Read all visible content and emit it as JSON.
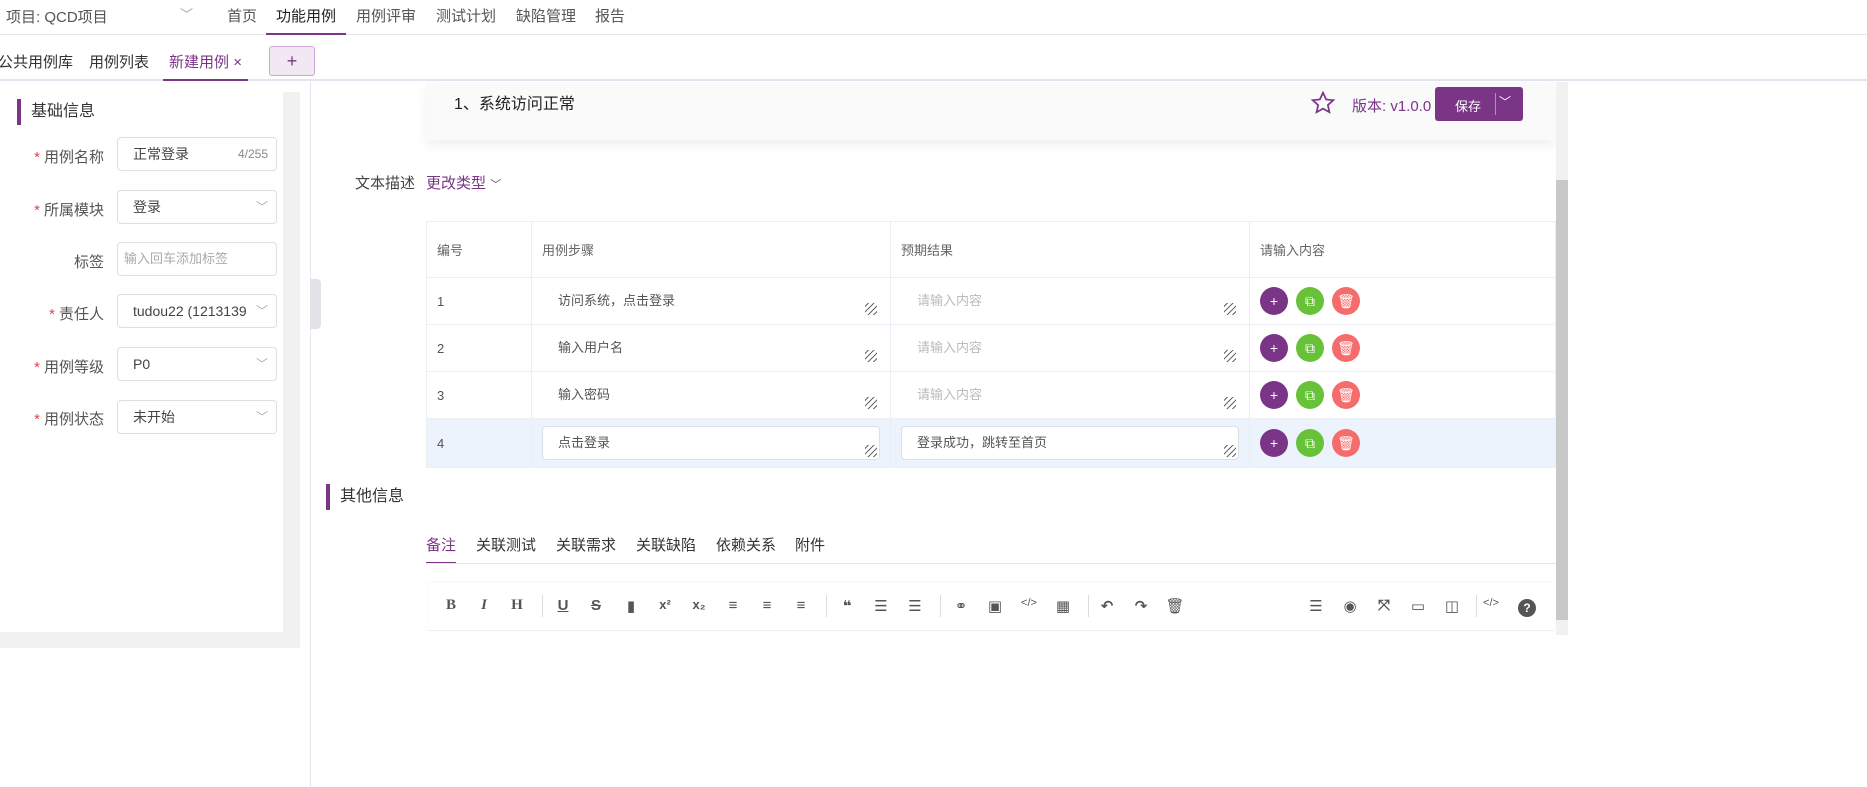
{
  "topnav": {
    "project": "项目: QCD项目",
    "items": [
      "首页",
      "功能用例",
      "用例评审",
      "测试计划",
      "缺陷管理",
      "报告"
    ],
    "active": 1
  },
  "tabs": {
    "items": [
      "公共用例库",
      "用例列表",
      "新建用例"
    ],
    "close": "×",
    "add": "+"
  },
  "basic": {
    "title": "基础信息",
    "fields": [
      {
        "label": "用例名称",
        "required": true,
        "value": "正常登录",
        "count": "4/255"
      },
      {
        "label": "所属模块",
        "required": true,
        "value": "登录"
      },
      {
        "label": "标签",
        "required": false,
        "placeholder": "输入回车添加标签"
      },
      {
        "label": "责任人",
        "required": true,
        "value": "tudou22 (1213139"
      },
      {
        "label": "用例等级",
        "required": true,
        "value": "P0"
      },
      {
        "label": "用例状态",
        "required": true,
        "value": "未开始"
      }
    ]
  },
  "card": {
    "text": "1、系统访问正常",
    "version": "版本: v1.0.0",
    "save": "保存"
  },
  "desc": {
    "label": "文本描述",
    "change_type": "更改类型"
  },
  "table": {
    "headers": [
      "编号",
      "用例步骤",
      "预期结果",
      "请输入内容"
    ],
    "placeholder": "请输入内容",
    "rows": [
      {
        "no": "1",
        "step": "访问系统，点击登录",
        "result": ""
      },
      {
        "no": "2",
        "step": "输入用户名",
        "result": ""
      },
      {
        "no": "3",
        "step": "输入密码",
        "result": ""
      },
      {
        "no": "4",
        "step": "点击登录",
        "result": "登录成功，跳转至首页"
      }
    ]
  },
  "other": {
    "title": "其他信息",
    "tabs": [
      "备注",
      "关联测试",
      "关联需求",
      "关联缺陷",
      "依赖关系",
      "附件"
    ]
  },
  "toolbar": {
    "bold": "B",
    "italic": "I",
    "heading": "H",
    "underline": "U",
    "strike": "S",
    "sup": "x²",
    "sub": "x₂",
    "quote": "❝",
    "code": "</>",
    "help": "?"
  },
  "colors": {
    "accent": "#7a3587",
    "add": "#7a3587",
    "copy": "#67c23a",
    "delete": "#f56c6c"
  }
}
